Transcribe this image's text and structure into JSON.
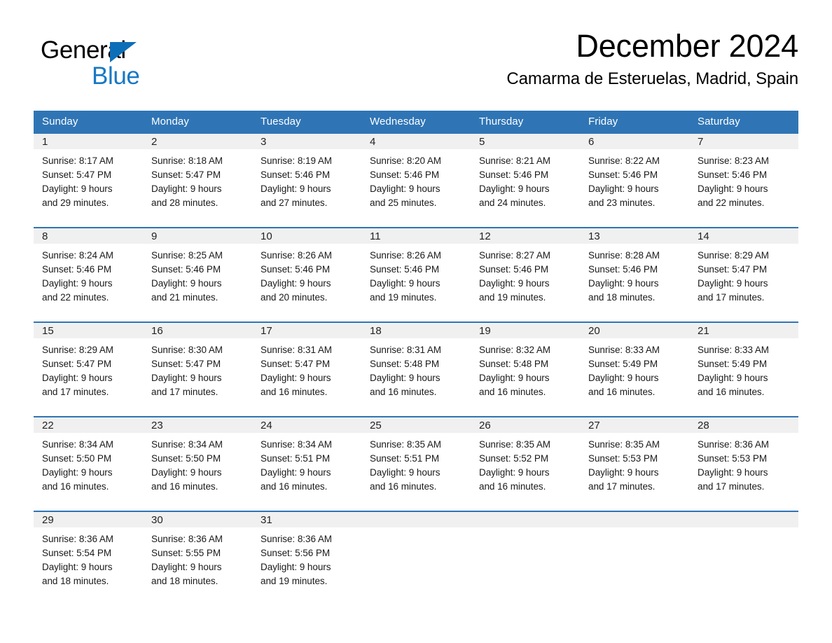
{
  "brand": {
    "name_part1": "General",
    "name_part2": "Blue",
    "triangle_color": "#0d6eb8",
    "blue_text_color": "#1878c4"
  },
  "header": {
    "title": "December 2024",
    "subtitle": "Camarma de Esteruelas, Madrid, Spain"
  },
  "theme": {
    "header_blue": "#2f75b5",
    "daynum_band": "#f0f0f0",
    "text": "#000000"
  },
  "calendar": {
    "month": "December",
    "year": "2024",
    "location": "Camarma de Esteruelas, Madrid, Spain",
    "day_headers": [
      "Sunday",
      "Monday",
      "Tuesday",
      "Wednesday",
      "Thursday",
      "Friday",
      "Saturday"
    ],
    "weeks": [
      [
        {
          "day": "1",
          "sunrise": "Sunrise: 8:17 AM",
          "sunset": "Sunset: 5:47 PM",
          "daylight_line1": "Daylight: 9 hours",
          "daylight_line2": "and 29 minutes."
        },
        {
          "day": "2",
          "sunrise": "Sunrise: 8:18 AM",
          "sunset": "Sunset: 5:47 PM",
          "daylight_line1": "Daylight: 9 hours",
          "daylight_line2": "and 28 minutes."
        },
        {
          "day": "3",
          "sunrise": "Sunrise: 8:19 AM",
          "sunset": "Sunset: 5:46 PM",
          "daylight_line1": "Daylight: 9 hours",
          "daylight_line2": "and 27 minutes."
        },
        {
          "day": "4",
          "sunrise": "Sunrise: 8:20 AM",
          "sunset": "Sunset: 5:46 PM",
          "daylight_line1": "Daylight: 9 hours",
          "daylight_line2": "and 25 minutes."
        },
        {
          "day": "5",
          "sunrise": "Sunrise: 8:21 AM",
          "sunset": "Sunset: 5:46 PM",
          "daylight_line1": "Daylight: 9 hours",
          "daylight_line2": "and 24 minutes."
        },
        {
          "day": "6",
          "sunrise": "Sunrise: 8:22 AM",
          "sunset": "Sunset: 5:46 PM",
          "daylight_line1": "Daylight: 9 hours",
          "daylight_line2": "and 23 minutes."
        },
        {
          "day": "7",
          "sunrise": "Sunrise: 8:23 AM",
          "sunset": "Sunset: 5:46 PM",
          "daylight_line1": "Daylight: 9 hours",
          "daylight_line2": "and 22 minutes."
        }
      ],
      [
        {
          "day": "8",
          "sunrise": "Sunrise: 8:24 AM",
          "sunset": "Sunset: 5:46 PM",
          "daylight_line1": "Daylight: 9 hours",
          "daylight_line2": "and 22 minutes."
        },
        {
          "day": "9",
          "sunrise": "Sunrise: 8:25 AM",
          "sunset": "Sunset: 5:46 PM",
          "daylight_line1": "Daylight: 9 hours",
          "daylight_line2": "and 21 minutes."
        },
        {
          "day": "10",
          "sunrise": "Sunrise: 8:26 AM",
          "sunset": "Sunset: 5:46 PM",
          "daylight_line1": "Daylight: 9 hours",
          "daylight_line2": "and 20 minutes."
        },
        {
          "day": "11",
          "sunrise": "Sunrise: 8:26 AM",
          "sunset": "Sunset: 5:46 PM",
          "daylight_line1": "Daylight: 9 hours",
          "daylight_line2": "and 19 minutes."
        },
        {
          "day": "12",
          "sunrise": "Sunrise: 8:27 AM",
          "sunset": "Sunset: 5:46 PM",
          "daylight_line1": "Daylight: 9 hours",
          "daylight_line2": "and 19 minutes."
        },
        {
          "day": "13",
          "sunrise": "Sunrise: 8:28 AM",
          "sunset": "Sunset: 5:46 PM",
          "daylight_line1": "Daylight: 9 hours",
          "daylight_line2": "and 18 minutes."
        },
        {
          "day": "14",
          "sunrise": "Sunrise: 8:29 AM",
          "sunset": "Sunset: 5:47 PM",
          "daylight_line1": "Daylight: 9 hours",
          "daylight_line2": "and 17 minutes."
        }
      ],
      [
        {
          "day": "15",
          "sunrise": "Sunrise: 8:29 AM",
          "sunset": "Sunset: 5:47 PM",
          "daylight_line1": "Daylight: 9 hours",
          "daylight_line2": "and 17 minutes."
        },
        {
          "day": "16",
          "sunrise": "Sunrise: 8:30 AM",
          "sunset": "Sunset: 5:47 PM",
          "daylight_line1": "Daylight: 9 hours",
          "daylight_line2": "and 17 minutes."
        },
        {
          "day": "17",
          "sunrise": "Sunrise: 8:31 AM",
          "sunset": "Sunset: 5:47 PM",
          "daylight_line1": "Daylight: 9 hours",
          "daylight_line2": "and 16 minutes."
        },
        {
          "day": "18",
          "sunrise": "Sunrise: 8:31 AM",
          "sunset": "Sunset: 5:48 PM",
          "daylight_line1": "Daylight: 9 hours",
          "daylight_line2": "and 16 minutes."
        },
        {
          "day": "19",
          "sunrise": "Sunrise: 8:32 AM",
          "sunset": "Sunset: 5:48 PM",
          "daylight_line1": "Daylight: 9 hours",
          "daylight_line2": "and 16 minutes."
        },
        {
          "day": "20",
          "sunrise": "Sunrise: 8:33 AM",
          "sunset": "Sunset: 5:49 PM",
          "daylight_line1": "Daylight: 9 hours",
          "daylight_line2": "and 16 minutes."
        },
        {
          "day": "21",
          "sunrise": "Sunrise: 8:33 AM",
          "sunset": "Sunset: 5:49 PM",
          "daylight_line1": "Daylight: 9 hours",
          "daylight_line2": "and 16 minutes."
        }
      ],
      [
        {
          "day": "22",
          "sunrise": "Sunrise: 8:34 AM",
          "sunset": "Sunset: 5:50 PM",
          "daylight_line1": "Daylight: 9 hours",
          "daylight_line2": "and 16 minutes."
        },
        {
          "day": "23",
          "sunrise": "Sunrise: 8:34 AM",
          "sunset": "Sunset: 5:50 PM",
          "daylight_line1": "Daylight: 9 hours",
          "daylight_line2": "and 16 minutes."
        },
        {
          "day": "24",
          "sunrise": "Sunrise: 8:34 AM",
          "sunset": "Sunset: 5:51 PM",
          "daylight_line1": "Daylight: 9 hours",
          "daylight_line2": "and 16 minutes."
        },
        {
          "day": "25",
          "sunrise": "Sunrise: 8:35 AM",
          "sunset": "Sunset: 5:51 PM",
          "daylight_line1": "Daylight: 9 hours",
          "daylight_line2": "and 16 minutes."
        },
        {
          "day": "26",
          "sunrise": "Sunrise: 8:35 AM",
          "sunset": "Sunset: 5:52 PM",
          "daylight_line1": "Daylight: 9 hours",
          "daylight_line2": "and 16 minutes."
        },
        {
          "day": "27",
          "sunrise": "Sunrise: 8:35 AM",
          "sunset": "Sunset: 5:53 PM",
          "daylight_line1": "Daylight: 9 hours",
          "daylight_line2": "and 17 minutes."
        },
        {
          "day": "28",
          "sunrise": "Sunrise: 8:36 AM",
          "sunset": "Sunset: 5:53 PM",
          "daylight_line1": "Daylight: 9 hours",
          "daylight_line2": "and 17 minutes."
        }
      ],
      [
        {
          "day": "29",
          "sunrise": "Sunrise: 8:36 AM",
          "sunset": "Sunset: 5:54 PM",
          "daylight_line1": "Daylight: 9 hours",
          "daylight_line2": "and 18 minutes."
        },
        {
          "day": "30",
          "sunrise": "Sunrise: 8:36 AM",
          "sunset": "Sunset: 5:55 PM",
          "daylight_line1": "Daylight: 9 hours",
          "daylight_line2": "and 18 minutes."
        },
        {
          "day": "31",
          "sunrise": "Sunrise: 8:36 AM",
          "sunset": "Sunset: 5:56 PM",
          "daylight_line1": "Daylight: 9 hours",
          "daylight_line2": "and 19 minutes."
        },
        null,
        null,
        null,
        null
      ]
    ]
  }
}
